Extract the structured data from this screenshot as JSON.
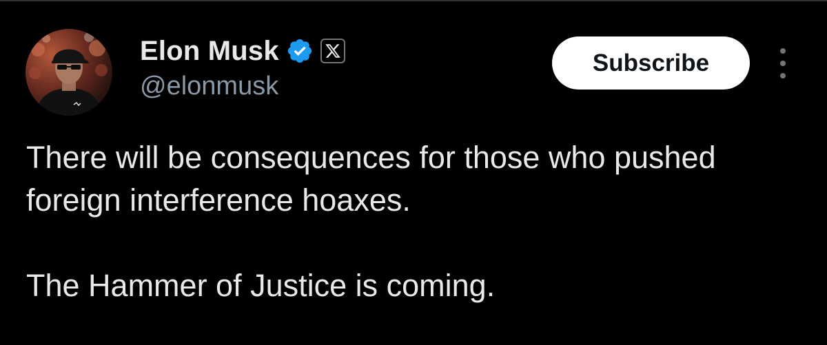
{
  "author": {
    "display_name": "Elon Musk",
    "handle": "@elonmusk",
    "verified": true,
    "affiliate_badge": "x-logo-icon"
  },
  "actions": {
    "subscribe_label": "Subscribe",
    "more_icon": "more-vertical-icon"
  },
  "tweet": {
    "paragraphs": [
      "There will be consequences for those who pushed foreign interference hoaxes.",
      "The Hammer of Justice is coming."
    ]
  },
  "colors": {
    "background": "#000000",
    "text_primary": "#e7e9ea",
    "text_secondary": "#8b98a5",
    "verified_blue": "#1d9bf0",
    "button_bg": "#ffffff",
    "button_text": "#0f1419"
  }
}
